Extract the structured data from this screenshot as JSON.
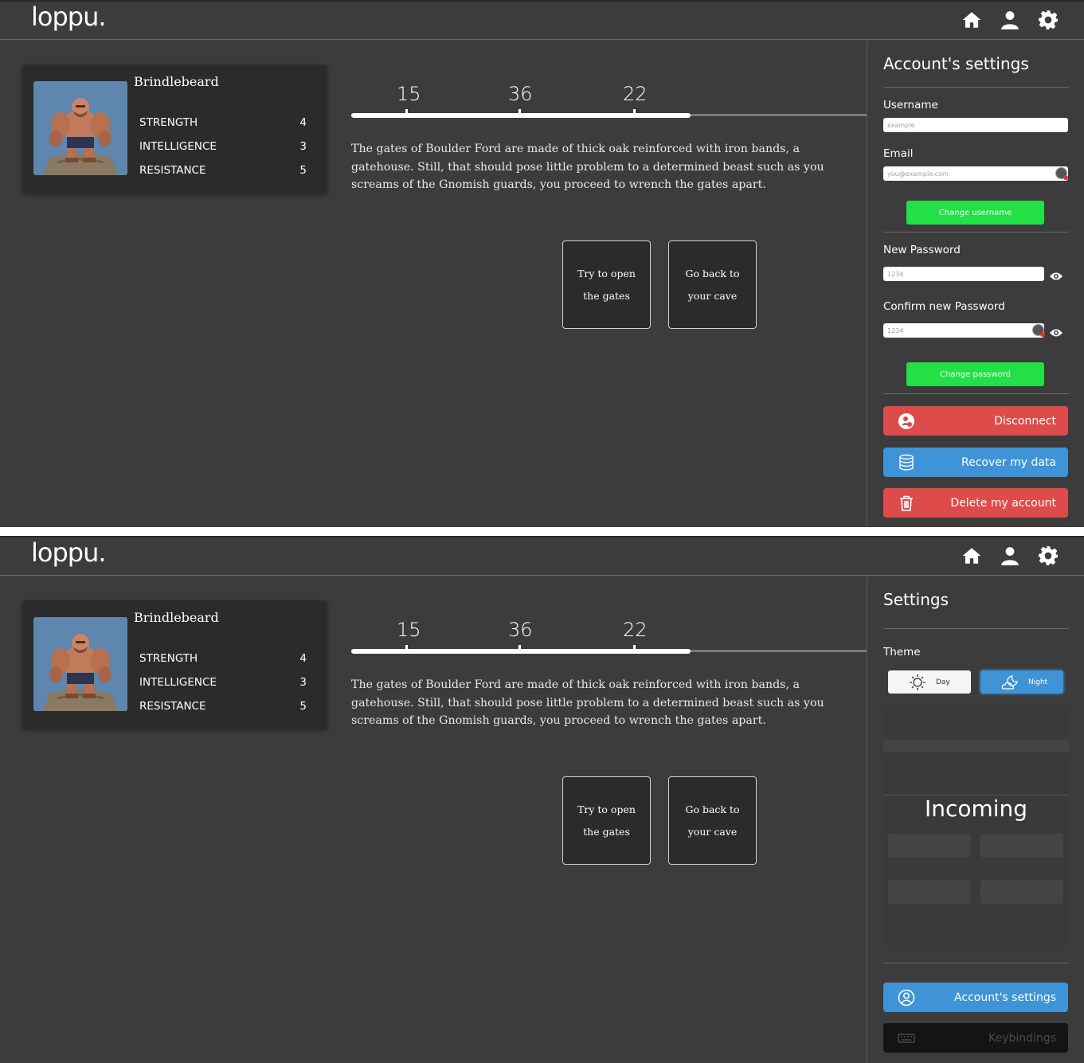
{
  "app": {
    "logo": "loppu.",
    "nav": [
      {
        "name": "home",
        "icon": "home-icon"
      },
      {
        "name": "profile",
        "icon": "user-icon"
      },
      {
        "name": "settings",
        "icon": "gear-icon"
      }
    ]
  },
  "character": {
    "name": "Brindlebeard",
    "stats": [
      {
        "label": "STRENGTH",
        "value": "4"
      },
      {
        "label": "INTELLIGENCE",
        "value": "3"
      },
      {
        "label": "RESISTANCE",
        "value": "5"
      }
    ]
  },
  "progress": {
    "numbers": [
      "15",
      "36",
      "22"
    ],
    "fraction": 0.658
  },
  "story": {
    "lines": [
      "The gates of Boulder Ford are made of thick oak reinforced with iron bands, a",
      "gatehouse. Still, that should pose little problem to a determined beast such as you",
      "screams of the Gnomish guards, you proceed to wrench the gates apart."
    ]
  },
  "choices": [
    {
      "line1": "Try to open",
      "line2": "the gates"
    },
    {
      "line1": "Go back to",
      "line2": "your cave"
    }
  ],
  "account_panel": {
    "title": "Account's settings",
    "username_label": "Username",
    "username_placeholder": "example",
    "email_label": "Email",
    "email_placeholder": "you@example.com",
    "change_username": "Change username",
    "new_password_label": "New Password",
    "new_password_placeholder": "1234",
    "confirm_password_label": "Confirm new Password",
    "confirm_password_placeholder": "1234",
    "change_password": "Change password",
    "disconnect": "Disconnect",
    "recover": "Recover my data",
    "delete": "Delete my account",
    "colors": {
      "green": "#22e046",
      "red": "#dd4b4b",
      "blue": "#3f94d8"
    }
  },
  "settings_panel": {
    "title": "Settings",
    "theme_label": "Theme",
    "day": "Day",
    "night": "Night",
    "incoming": "Incoming",
    "account_settings": "Account's settings",
    "keybindings": "Keybindings"
  }
}
